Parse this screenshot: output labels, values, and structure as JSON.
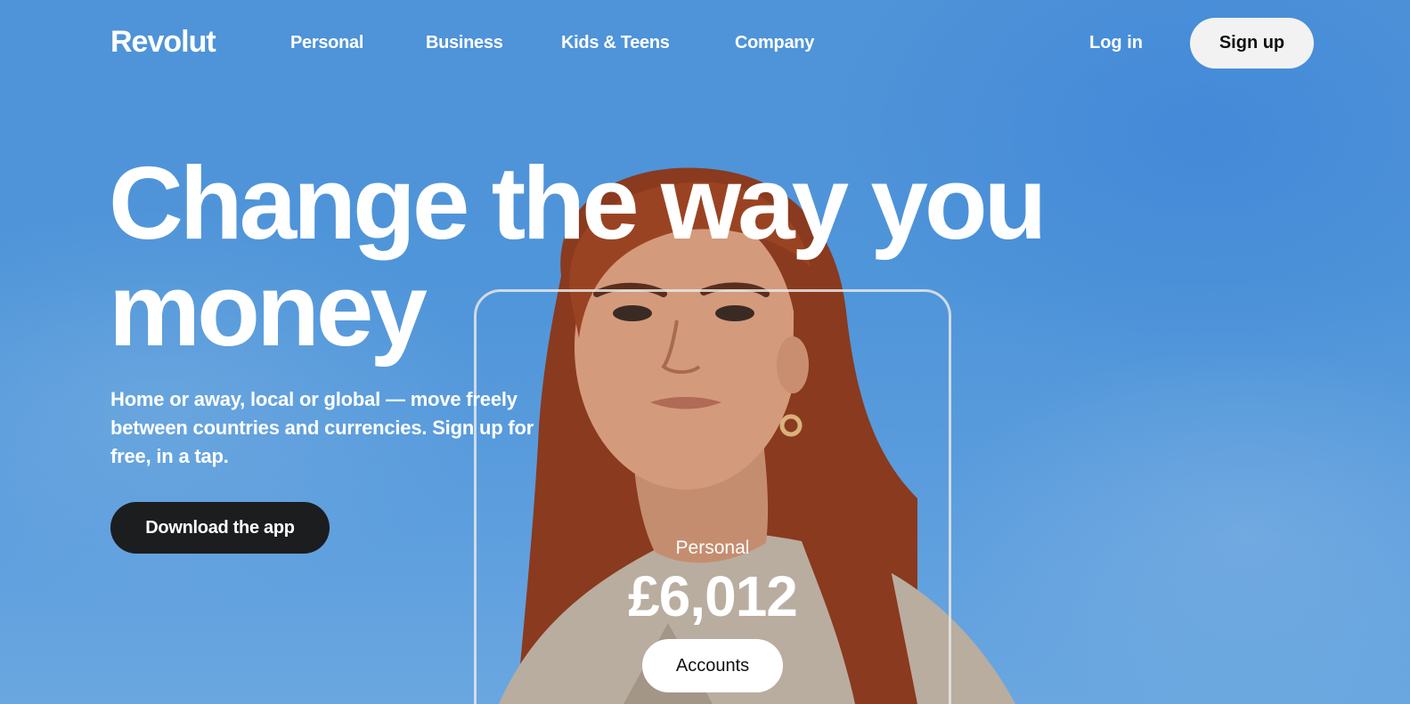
{
  "nav": {
    "logo": "Revolut",
    "links": [
      {
        "label": "Personal"
      },
      {
        "label": "Business"
      },
      {
        "label": "Kids & Teens"
      },
      {
        "label": "Company"
      }
    ],
    "login_label": "Log in",
    "signup_label": "Sign up"
  },
  "hero": {
    "headline_line1": "Change the way you",
    "headline_line2": "money",
    "subtext": "Home or away, local or global — move freely between countries and currencies. Sign up for free, in a tap.",
    "cta_label": "Download the app"
  },
  "card": {
    "label": "Personal",
    "amount": "£6,012",
    "button_label": "Accounts"
  },
  "colors": {
    "sky": "#4f93d8",
    "cta_dark": "#1c1d1f",
    "signup_bg": "#f2f2f2"
  }
}
